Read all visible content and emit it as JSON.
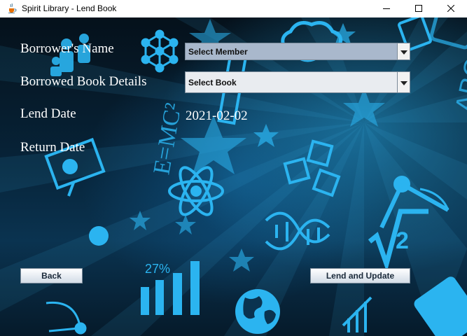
{
  "window": {
    "title": "Spirit Library - Lend Book",
    "icon": "java-cup-icon",
    "controls": [
      "minimize-icon",
      "maximize-icon",
      "close-icon"
    ]
  },
  "form": {
    "borrower_label": "Borrower's Name",
    "book_label": "Borrowed Book Details",
    "lend_date_label": "Lend Date",
    "return_date_label": "Return Date",
    "member_combo_value": "Select Member",
    "book_combo_value": "Select Book",
    "lend_date_value": "2021-02-02"
  },
  "buttons": {
    "back_label": "Back",
    "lend_label": "Lend and Update"
  },
  "background": {
    "percent_text": "27%",
    "abc_text": "ABC",
    "formula_text": "E=MC²",
    "accent_color": "#2bb4f0",
    "dark_color": "#05111b"
  }
}
